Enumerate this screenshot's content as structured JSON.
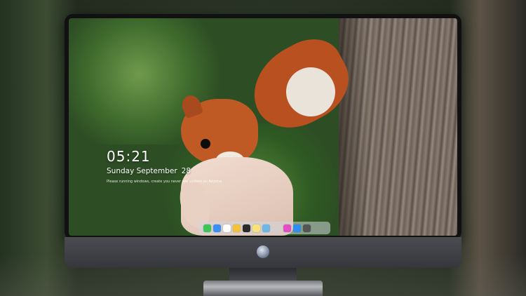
{
  "lock_screen": {
    "time": "05:21",
    "weekday_month": "Sunday September",
    "day": "28",
    "notice": "Please running windows, create you never see system on Arizona"
  },
  "dock": {
    "left_items": [
      {
        "icon": "messages-icon",
        "color": "#3ec55a"
      },
      {
        "icon": "finder-icon",
        "color": "#3b8ff0"
      },
      {
        "icon": "safari-icon",
        "color": "#ffffff"
      },
      {
        "icon": "photos-icon",
        "color": "#f4c23a"
      },
      {
        "icon": "clapper-icon",
        "color": "#2a2a2a"
      },
      {
        "icon": "notes-icon",
        "color": "#f7e37a"
      },
      {
        "icon": "preview-icon",
        "color": "#6fb6e6"
      }
    ],
    "right_items": [
      {
        "icon": "itunes-icon",
        "color": "#e54fc4"
      },
      {
        "icon": "app-store-icon",
        "color": "#2f8ef0"
      },
      {
        "icon": "camera-icon",
        "color": "#555555"
      }
    ]
  }
}
